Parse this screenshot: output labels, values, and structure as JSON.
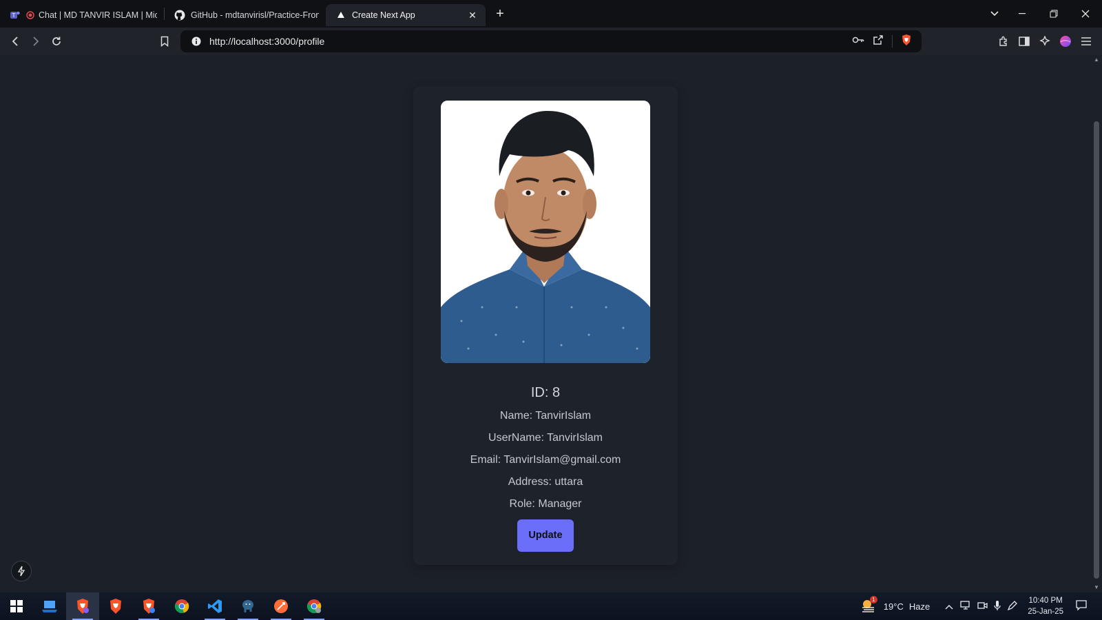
{
  "browser": {
    "tabs": [
      {
        "title": "Chat | MD TANVIR ISLAM | Micro",
        "icon": "teams-icon"
      },
      {
        "title": "GitHub - mdtanvirisl/Practice-Fronte",
        "icon": "github-icon"
      },
      {
        "title": "Create Next App",
        "icon": "nextjs-icon",
        "active": true
      }
    ],
    "url": "http://localhost:3000/profile"
  },
  "profile": {
    "id_line": "ID: 8",
    "name_line": "Name: TanvirIslam",
    "username_line": "UserName: TanvirIslam",
    "email_line": "Email: TanvirIslam@gmail.com",
    "address_line": "Address: uttara",
    "role_line": "Role: Manager",
    "update_label": "Update",
    "photo": "profile-photo"
  },
  "taskbar": {
    "weather": {
      "temp": "19°C",
      "condition": "Haze",
      "badge": "1"
    },
    "time": "10:40 PM",
    "date": "25-Jan-25"
  },
  "colors": {
    "page_bg": "#1c2029",
    "accent_button": "#6b6ef8",
    "text": "#c5c8ce"
  }
}
